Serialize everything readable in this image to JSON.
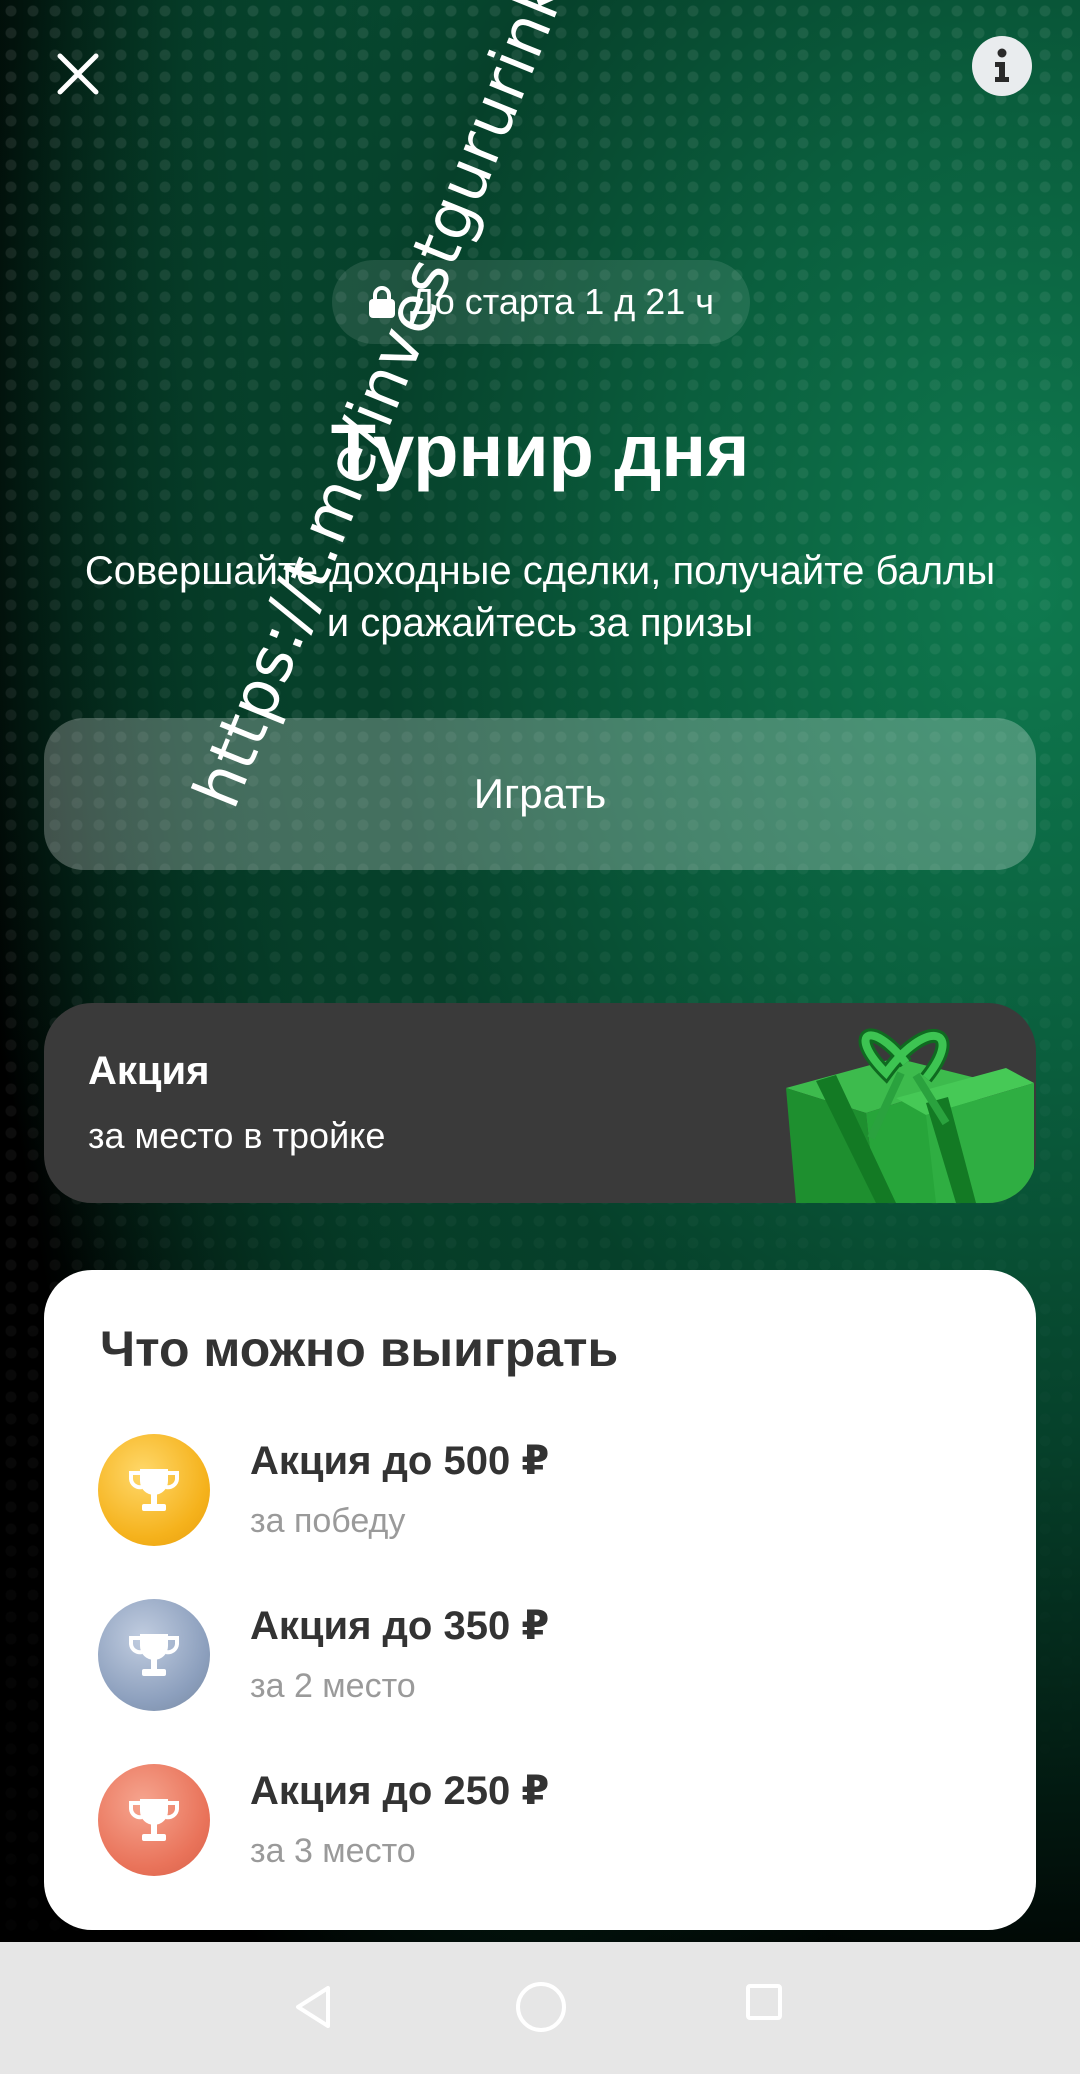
{
  "header": {
    "close_icon": "close-icon",
    "info_icon": "info-icon"
  },
  "timer": {
    "icon": "lock-icon",
    "label": "До старта 1 д 21 ч"
  },
  "tournament": {
    "title": "Турнир дня",
    "description": "Совершайте доходные сделки, получайте баллы и сражайтесь за призы",
    "play_label": "Играть"
  },
  "promo": {
    "title": "Акция",
    "subtitle": "за место в тройке",
    "image_icon": "gift-icon"
  },
  "prizes": {
    "title": "Что можно выиграть",
    "items": [
      {
        "name": "Акция до 500 ₽",
        "condition": "за победу",
        "color": "#f5b21c",
        "icon": "trophy-icon"
      },
      {
        "name": "Акция до 350 ₽",
        "condition": "за 2 место",
        "color": "#8c9fbd",
        "icon": "trophy-icon"
      },
      {
        "name": "Акция до 250 ₽",
        "condition": "за 3 место",
        "color": "#e9735a",
        "icon": "trophy-icon"
      }
    ]
  },
  "watermark": "https://t.me/investgururinka",
  "navbar": {
    "back_icon": "back-triangle-icon",
    "home_icon": "home-circle-icon",
    "recent_icon": "recent-square-icon"
  }
}
